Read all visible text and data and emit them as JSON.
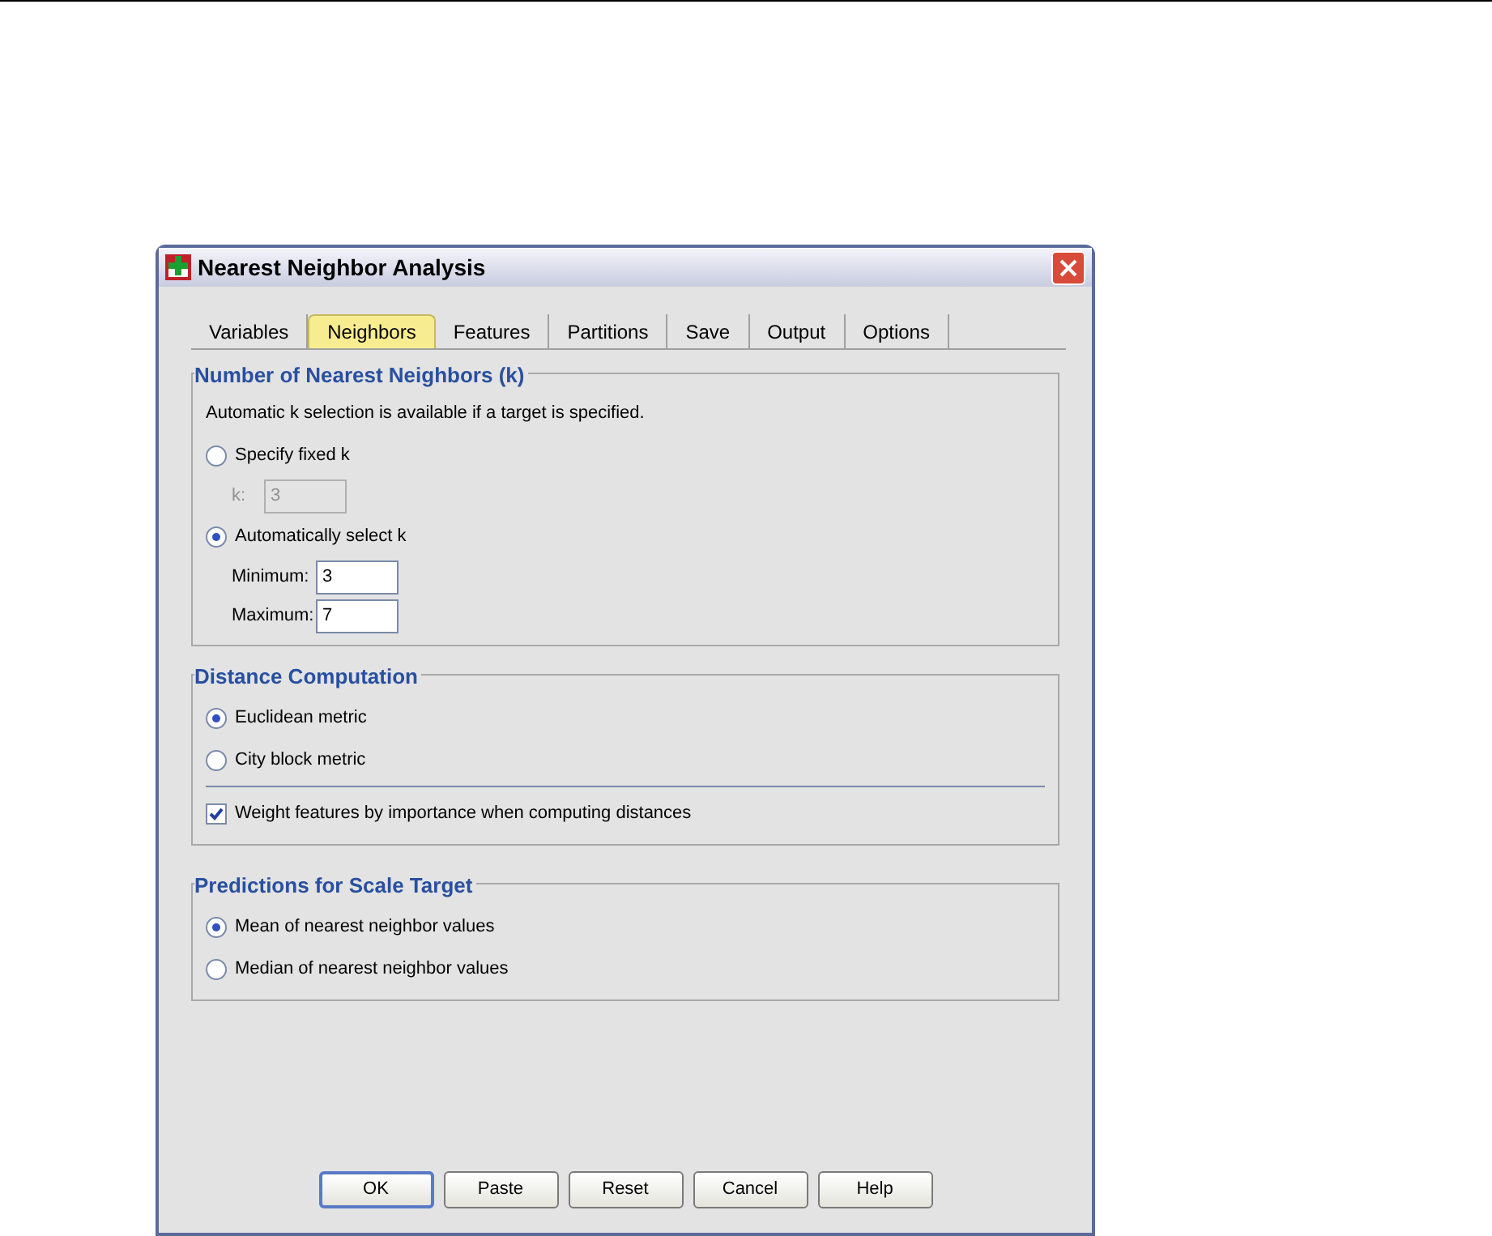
{
  "window": {
    "title": "Nearest Neighbor Analysis"
  },
  "tabs": [
    {
      "label": "Variables",
      "selected": false
    },
    {
      "label": "Neighbors",
      "selected": true
    },
    {
      "label": "Features",
      "selected": false
    },
    {
      "label": "Partitions",
      "selected": false
    },
    {
      "label": "Save",
      "selected": false
    },
    {
      "label": "Output",
      "selected": false
    },
    {
      "label": "Options",
      "selected": false
    }
  ],
  "groups": [
    {
      "title": "Number of Nearest Neighbors (k)",
      "items": [
        {
          "kind": "note",
          "text": "Automatic k selection is available if a target is specified."
        },
        {
          "kind": "radio",
          "label": "Specify fixed k",
          "selected": false
        },
        {
          "kind": "field",
          "label": "k:",
          "value": "3",
          "disabled": true
        },
        {
          "kind": "radio",
          "label": "Automatically select k",
          "selected": true
        },
        {
          "kind": "field",
          "label": "Minimum:",
          "value": "3",
          "disabled": false
        },
        {
          "kind": "field",
          "label": "Maximum:",
          "value": "7",
          "disabled": false
        }
      ]
    },
    {
      "title": "Distance Computation",
      "items": [
        {
          "kind": "radio",
          "label": "Euclidean metric",
          "selected": true
        },
        {
          "kind": "radio",
          "label": "City block metric",
          "selected": false
        },
        {
          "kind": "separator"
        },
        {
          "kind": "checkbox",
          "label": "Weight features by importance when computing distances",
          "checked": true
        }
      ]
    },
    {
      "title": "Predictions for Scale Target",
      "items": [
        {
          "kind": "radio",
          "label": "Mean of nearest neighbor values",
          "selected": true
        },
        {
          "kind": "radio",
          "label": "Median of nearest neighbor values",
          "selected": false
        }
      ]
    }
  ],
  "buttons": [
    {
      "label": "OK",
      "default": true
    },
    {
      "label": "Paste",
      "default": false
    },
    {
      "label": "Reset",
      "default": false
    },
    {
      "label": "Cancel",
      "default": false
    },
    {
      "label": "Help",
      "default": false
    }
  ]
}
